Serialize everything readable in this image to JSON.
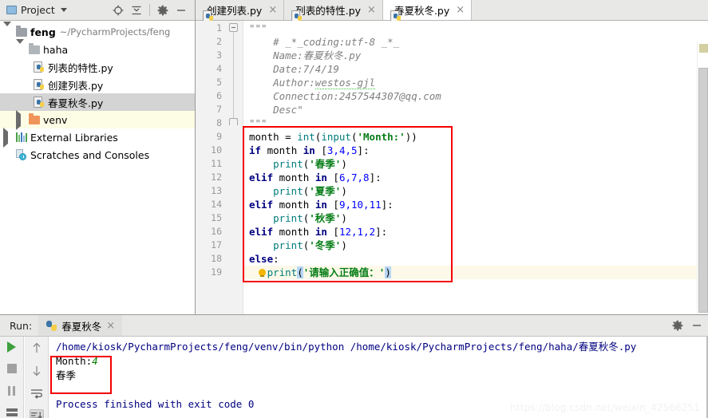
{
  "project_panel": {
    "title": "Project",
    "icons": [
      "target-icon",
      "collapse-all-icon",
      "gear-icon",
      "minimize-icon"
    ],
    "tree": [
      {
        "label": "feng",
        "path": "~/PycharmProjects/feng",
        "icon": "folder-icon",
        "expanded": true,
        "depth": 0,
        "bold": true
      },
      {
        "label": "haha",
        "path": "",
        "icon": "folder-icon",
        "expanded": true,
        "depth": 1,
        "bold": false
      },
      {
        "label": "列表的特性.py",
        "path": "",
        "icon": "python-file-icon",
        "depth": 2,
        "bold": false
      },
      {
        "label": "创建列表.py",
        "path": "",
        "icon": "python-file-icon",
        "depth": 2,
        "bold": false
      },
      {
        "label": "春夏秋冬.py",
        "path": "",
        "icon": "python-file-icon",
        "depth": 2,
        "bold": false,
        "selected": true
      },
      {
        "label": "venv",
        "path": "",
        "icon": "folder-orange-icon",
        "expanded": false,
        "depth": 1,
        "bold": false,
        "highlighted": true
      },
      {
        "label": "External Libraries",
        "path": "",
        "icon": "libraries-icon",
        "expanded": false,
        "depth": 0,
        "bold": false
      },
      {
        "label": "Scratches and Consoles",
        "path": "",
        "icon": "scratches-icon",
        "depth": 0,
        "bold": false
      }
    ]
  },
  "editor": {
    "tabs": [
      {
        "label": "创建列表.py",
        "icon": "python-file-icon",
        "active": false,
        "close": "×"
      },
      {
        "label": "列表的特性.py",
        "icon": "python-file-icon",
        "active": false,
        "close": "×"
      },
      {
        "label": "春夏秋冬.py",
        "icon": "python-file-icon",
        "active": true,
        "close": "×"
      }
    ],
    "line_numbers": [
      1,
      2,
      3,
      4,
      5,
      6,
      7,
      8,
      9,
      10,
      11,
      12,
      13,
      14,
      15,
      16,
      17,
      18,
      19
    ],
    "code_lines": [
      {
        "n": 1,
        "text": "\"\"\""
      },
      {
        "n": 2,
        "text": "    # _*_coding:utf-8 _*_"
      },
      {
        "n": 3,
        "text": "    Name:春夏秋冬.py"
      },
      {
        "n": 4,
        "text": "    Date:7/4/19"
      },
      {
        "n": 5,
        "text": "    Author:westos-gjl"
      },
      {
        "n": 6,
        "text": "    Connection:2457544307@qq.com"
      },
      {
        "n": 7,
        "text": "    Desc\""
      },
      {
        "n": 8,
        "text": "\"\"\""
      },
      {
        "n": 9,
        "text": "month = int(input('Month:'))"
      },
      {
        "n": 10,
        "text": "if month in [3,4,5]:"
      },
      {
        "n": 11,
        "text": "    print('春季')"
      },
      {
        "n": 12,
        "text": "elif month in [6,7,8]:"
      },
      {
        "n": 13,
        "text": "    print('夏季')"
      },
      {
        "n": 14,
        "text": "elif month in [9,10,11]:"
      },
      {
        "n": 15,
        "text": "    print('秋季')"
      },
      {
        "n": 16,
        "text": "elif month in [12,1,2]:"
      },
      {
        "n": 17,
        "text": "    print('冬季')"
      },
      {
        "n": 18,
        "text": "else:"
      },
      {
        "n": 19,
        "text": "    print('请输入正确值：')"
      }
    ],
    "tokens": {
      "quote": "\"\"\"",
      "doc2": "# _*_coding:utf-8 _*_",
      "doc3": "Name:春夏秋冬.py",
      "doc4": "Date:7/4/19",
      "doc5a": "Author:",
      "doc5b": "westos-gjl",
      "doc6": "Connection:2457544307@qq.com",
      "doc7": "Desc\"",
      "month_var": "month",
      "eq": " = ",
      "int_fn": "int",
      "input_fn": "input",
      "str_month": "'Month:'",
      "kw_if": "if",
      "kw_elif": "elif",
      "kw_else": "else",
      "kw_in": "in",
      "print_fn": "print",
      "list_345": "3,4,5",
      "list_678": "6,7,8",
      "list_91011": "9,10,11",
      "list_1212": "12,1,2",
      "s_spring": "'春季'",
      "s_summer": "'夏季'",
      "s_autumn": "'秋季'",
      "s_winter": "'冬季'",
      "s_error": "'请输入正确值：'",
      "colon": ":",
      "lb": "[",
      "rb": "]",
      "lp": "(",
      "rp": ")"
    },
    "highlight_color": "#f40000"
  },
  "run_panel": {
    "label": "Run:",
    "tab_label": "春夏秋冬",
    "tab_close": "×",
    "icons": [
      "run-icon",
      "stop-icon",
      "pause-icon",
      "keyboard-icon",
      "up-arrow-icon",
      "down-arrow-icon",
      "soft-wrap-icon",
      "scroll-to-end-icon",
      "gear-icon",
      "minimize-icon"
    ],
    "console": {
      "command": "/home/kiosk/PycharmProjects/feng/venv/bin/python /home/kiosk/PycharmProjects/feng/haha/春夏秋冬.py",
      "prompt_label": "Month:",
      "prompt_value": "4",
      "output": "春季",
      "exit_line": "Process finished with exit code 0"
    },
    "highlight_color": "#f40000"
  },
  "watermark": "https://blog.csdn.net/weixin_42566251"
}
